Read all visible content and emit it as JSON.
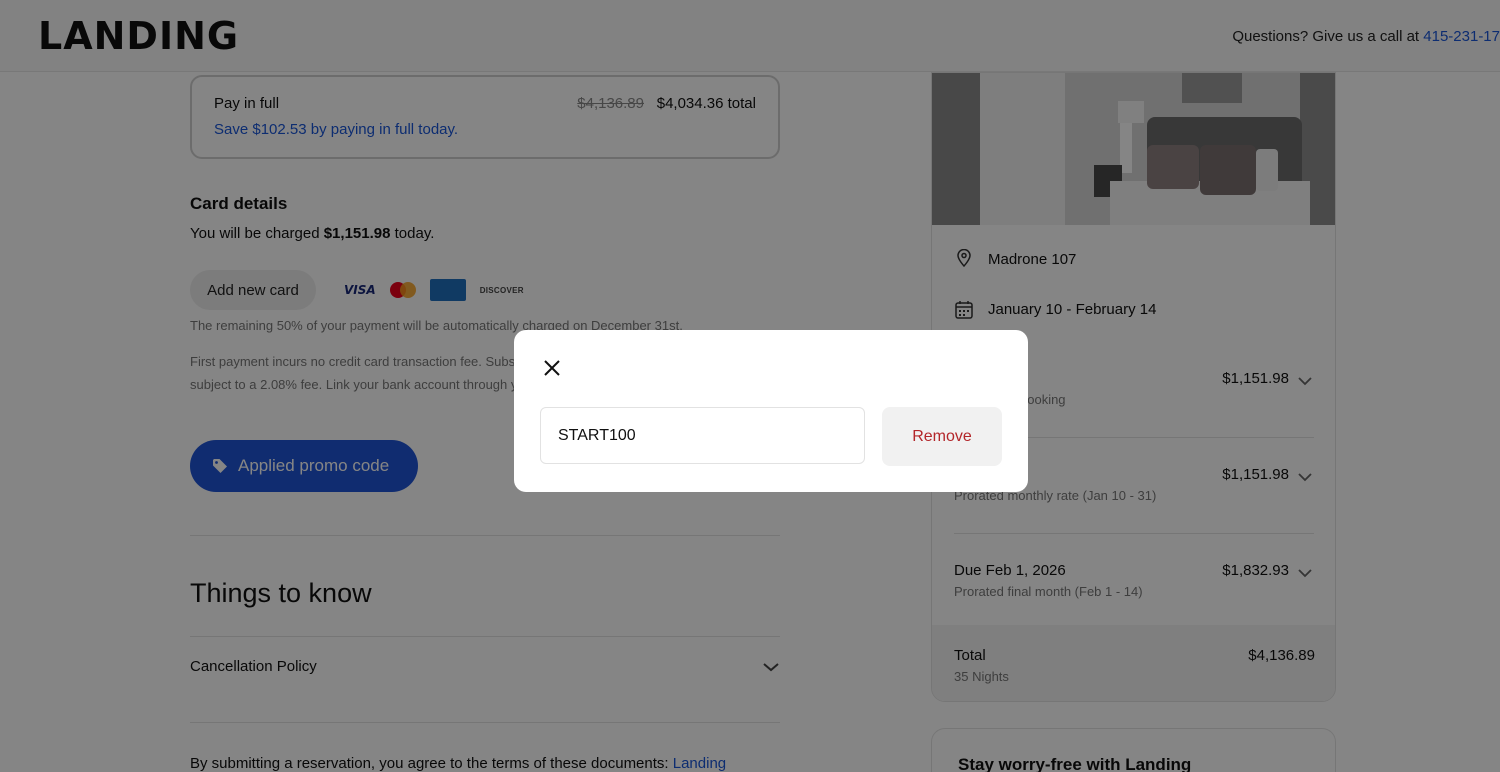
{
  "header": {
    "logo": "LANDING",
    "contact_prefix": "Questions? Give us a call at ",
    "phone": "415-231-17"
  },
  "payment": {
    "pay_full_title": "Pay in full",
    "pay_full_savings": "Save $102.53 by paying in full today.",
    "pay_full_old_price": "$4,136.89",
    "pay_full_total": "$4,034.36 total"
  },
  "card_details": {
    "heading": "Card details",
    "charged_prefix": "You will be charged ",
    "charged_amount": "$1,151.98",
    "charged_suffix": " today.",
    "add_card_label": "Add new card",
    "card_brands": [
      "visa-logo",
      "mastercard-logo",
      "amex-logo",
      "discover-logo"
    ],
    "visa_text": "VISA",
    "discover_text": "DISCOVER",
    "fine_print_1": "The remaining 50% of your payment will be automatically charged on December 31st.",
    "fine_print_2": "First payment incurs no credit card transaction fee. Subs",
    "fine_print_3": "subject to a 2.08% fee. Link your bank account through y"
  },
  "promo": {
    "button_label": "Applied promo code",
    "icon": "tag-icon"
  },
  "things_to_know": {
    "heading": "Things to know",
    "cancellation_label": "Cancellation Policy",
    "terms_prefix": "By submitting a reservation, you agree to the terms of these documents: ",
    "terms_link": "Landing"
  },
  "summary": {
    "location": "Madrone 107",
    "start_date": "January 10",
    "date_separator": " - ",
    "end_date": "February 14",
    "rows": [
      {
        "label": "",
        "amount": "$1,151.98",
        "sub": "booking"
      },
      {
        "label": "",
        "amount": "$1,151.98",
        "sub": "Prorated monthly rate (Jan 10 - 31)"
      },
      {
        "label": "Due Feb 1, 2026",
        "amount": "$1,832.93",
        "sub": "Prorated final month (Feb 1 - 14)"
      }
    ],
    "total_label": "Total",
    "total_amount": "$4,136.89",
    "total_nights": "35 Nights"
  },
  "worry": {
    "heading": "Stay worry-free with Landing"
  },
  "modal": {
    "promo_code_value": "START100",
    "remove_label": "Remove"
  },
  "colors": {
    "accent_blue": "#1f55d6",
    "link_blue": "#1a56d8",
    "remove_red": "#b3262a"
  }
}
